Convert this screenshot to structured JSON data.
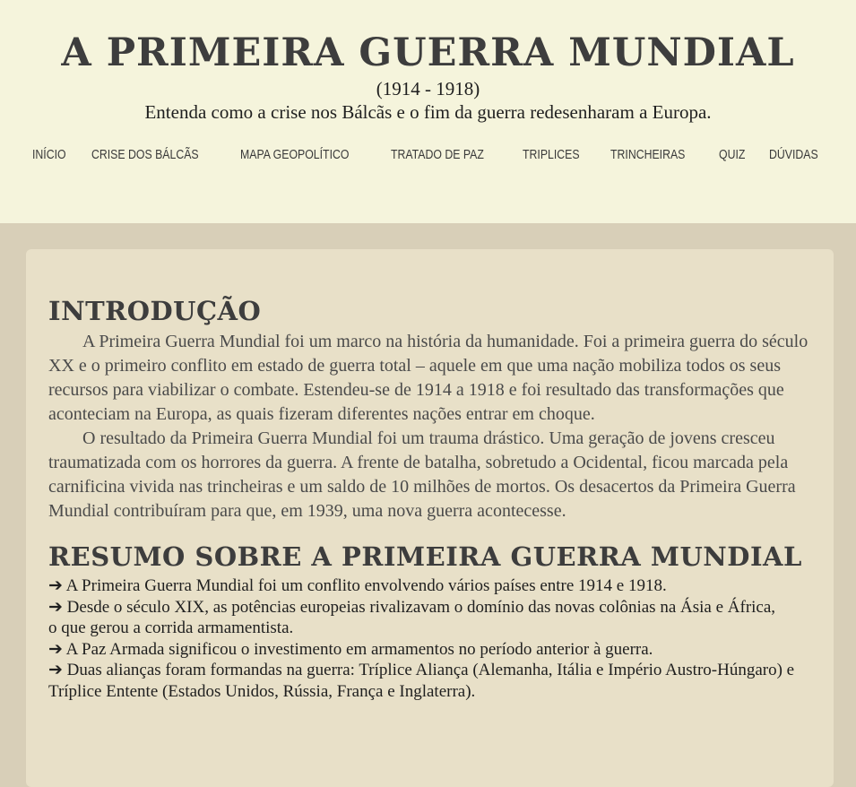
{
  "header": {
    "title": "A PRIMEIRA GUERRA MUNDIAL",
    "dates": "(1914 - 1918)",
    "subtitle": "Entenda como a crise nos Bálcãs e o fim da guerra redesenharam a Europa."
  },
  "nav": {
    "items": [
      {
        "label": "INÍCIO"
      },
      {
        "label": "CRISE DOS BÁLCÃS"
      },
      {
        "label": "MAPA GEOPOLÍTICO"
      },
      {
        "label": "TRATADO DE PAZ"
      },
      {
        "label": "TRIPLICES"
      },
      {
        "label": "TRINCHEIRAS"
      },
      {
        "label": "QUIZ"
      },
      {
        "label": "DÚVIDAS"
      }
    ]
  },
  "intro": {
    "heading": "INTRODUÇÃO",
    "paragraphs": [
      "A Primeira Guerra Mundial foi um marco na história da humanidade. Foi a primeira guerra do século XX e o primeiro conflito em estado de guerra total – aquele em que uma nação mobiliza todos os seus recursos para viabilizar o combate. Estendeu-se de 1914 a 1918 e foi resultado das transformações que aconteciam na Europa, as quais fizeram diferentes nações entrar em choque.",
      "O resultado da Primeira Guerra Mundial foi um trauma drástico. Uma geração de jovens cresceu traumatizada com os horrores da guerra. A frente de batalha, sobretudo a Ocidental, ficou marcada pela carnificina vivida nas trincheiras e um saldo de 10 milhões de mortos. Os desacertos da Primeira Guerra Mundial contribuíram para que, em 1939, uma nova guerra acontecesse."
    ]
  },
  "summary": {
    "heading": "RESUMO SOBRE A PRIMEIRA GUERRA MUNDIAL",
    "items": [
      "➔ A Primeira Guerra Mundial foi um conflito envolvendo vários países entre 1914 e 1918.",
      "➔ Desde o século XIX, as potências europeias rivalizavam o domínio das novas colônias na Ásia e África,",
      "o que gerou a corrida armamentista.",
      "➔ A Paz Armada significou o investimento em armamentos no período anterior à guerra.",
      "➔ Duas alianças foram formandas na guerra: Tríplice Aliança (Alemanha, Itália e Império Austro-Húngaro) e Tríplice Entente (Estados Unidos, Rússia, França e Inglaterra)."
    ]
  }
}
